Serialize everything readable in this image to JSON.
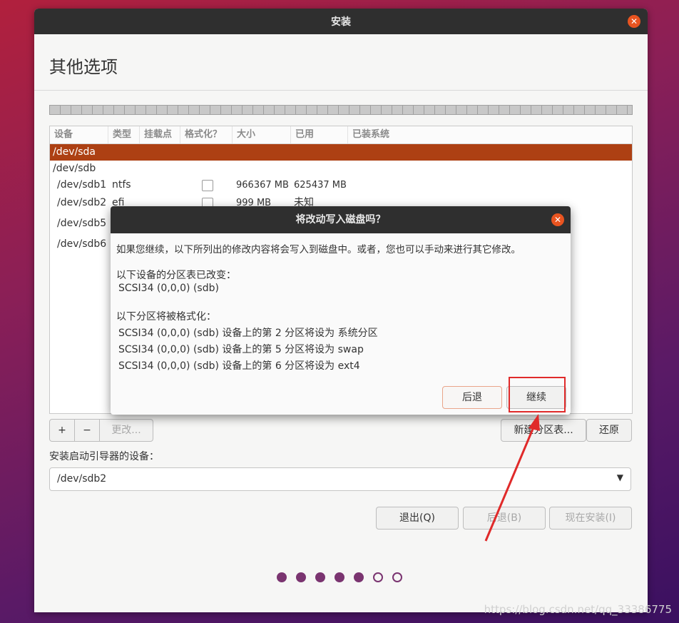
{
  "window": {
    "title": "安装"
  },
  "page": {
    "heading": "其他选项"
  },
  "table": {
    "headers": [
      "设备",
      "类型",
      "挂载点",
      "格式化？",
      "大小",
      "已用",
      "已装系统"
    ],
    "rows": [
      {
        "device": "/dev/sda",
        "type": "",
        "size": "",
        "used": "",
        "selected": true
      },
      {
        "device": "/dev/sdb",
        "type": "",
        "size": "",
        "used": ""
      },
      {
        "device": "/dev/sdb1",
        "type": "ntfs",
        "size": "966367 MB",
        "used": "625437 MB"
      },
      {
        "device": "/dev/sdb2",
        "type": "efi",
        "size": "999 MB",
        "used": "未知"
      },
      {
        "device": "/dev/sdb5",
        "type": "",
        "size": "",
        "used": ""
      },
      {
        "device": "/dev/sdb6",
        "type": "",
        "size": "",
        "used": ""
      }
    ]
  },
  "toolbar": {
    "add": "+",
    "remove": "−",
    "change": "更改...",
    "new_table": "新建分区表...",
    "revert": "还原"
  },
  "bootloader": {
    "label": "安装启动引导器的设备：",
    "value": "/dev/sdb2"
  },
  "nav": {
    "quit": "退出(Q)",
    "back": "后退(B)",
    "install": "现在安装(I)"
  },
  "progress": {
    "filled": 5,
    "total": 7
  },
  "dialog": {
    "title": "将改动写入磁盘吗？",
    "intro": "如果您继续，以下所列出的修改内容将会写入到磁盘中。或者，您也可以手动来进行其它修改。",
    "changed_heading": "以下设备的分区表已改变：",
    "changed_device": "SCSI34 (0,0,0) (sdb)",
    "format_heading": "以下分区将被格式化：",
    "format_items": [
      "SCSI34 (0,0,0) (sdb) 设备上的第 2 分区将设为 系统分区",
      "SCSI34 (0,0,0) (sdb) 设备上的第 5 分区将设为 swap",
      "SCSI34 (0,0,0) (sdb) 设备上的第 6 分区将设为 ext4"
    ],
    "back_label": "后退",
    "continue_label": "继续"
  },
  "colors": {
    "accent": "#e95420",
    "selected_row": "#ad4013",
    "annotation": "#e02a2a",
    "dot": "#7a3470"
  },
  "watermark": "https://blog.csdn.net/qq_33386775"
}
